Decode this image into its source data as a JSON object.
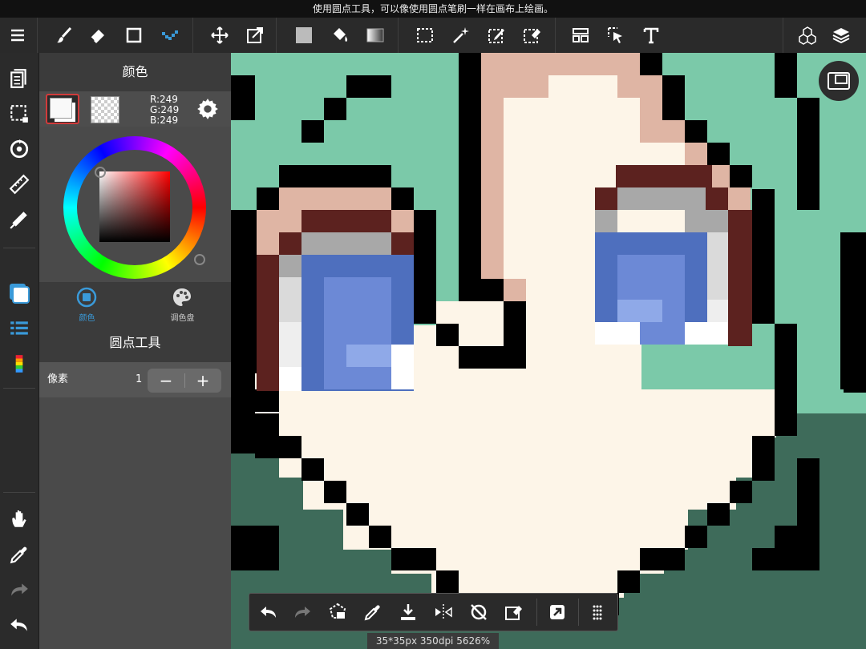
{
  "hint": "使用圆点工具，可以像使用圆点笔刷一样在画布上绘画。",
  "toolbar": {
    "tools": [
      "menu-icon",
      "brush-icon",
      "eraser-icon",
      "shape-icon",
      "dot-tool-icon",
      "move-icon",
      "transform-icon",
      "fill-color-icon",
      "bucket-icon",
      "gradient-icon",
      "selection-icon",
      "magic-wand-icon",
      "select-pen-icon",
      "select-eraser-icon",
      "panel-layout-icon",
      "operation-icon",
      "text-icon",
      "3d-model-icon",
      "layers-icon"
    ]
  },
  "left_toolbar": {
    "tools": [
      "page-icon",
      "selection-toggle-icon",
      "rotate-icon",
      "ruler-icon",
      "snap-icon",
      "color-icon",
      "brush-list-icon",
      "gradient-list-icon",
      "hand-icon",
      "eyedropper-icon",
      "redo-icon",
      "undo-icon"
    ]
  },
  "color_panel": {
    "title": "颜色",
    "rgb": {
      "r": "R:249",
      "g": "G:249",
      "b": "B:249"
    },
    "main_color": "#f9f9f9",
    "tabs": [
      {
        "label": "颜色",
        "active": true
      },
      {
        "label": "调色盘",
        "active": false
      }
    ]
  },
  "tool_panel": {
    "title": "圆点工具",
    "pixel_label": "像素",
    "pixel_value": "1",
    "minus": "−",
    "plus": "+"
  },
  "bottom_bar": {
    "tools": [
      "undo-icon",
      "redo-icon",
      "selection-clear-icon",
      "eyedropper-icon",
      "save-icon",
      "flip-icon",
      "rotate-reset-icon",
      "erase-select-icon",
      "share-icon",
      "more-icon"
    ]
  },
  "status": "35*35px 350dpi 5626%",
  "colors": {
    "outline": "#000000",
    "skin": "#fdf5e8",
    "skin_shade": "#dfb5a4",
    "bg_light": "#7bc9a9",
    "bg_dark": "#3e6b5a",
    "eye_blue": "#4e6fbe",
    "eye_light": "#6c89d6",
    "eye_highlight": "#8fa9e8",
    "eye_gray": "#a8a8a8",
    "eye_lightgray": "#dadada",
    "eye_brown": "#5c221f"
  }
}
